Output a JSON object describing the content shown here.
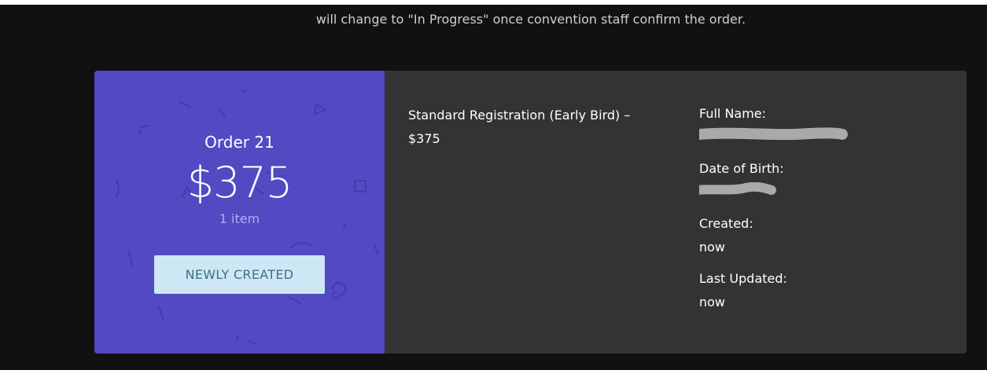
{
  "notice": {
    "text": "will change to \"In Progress\" once convention staff confirm the order."
  },
  "order": {
    "title": "Order 21",
    "total": "$375",
    "item_count": "1 item",
    "status_label": "NEWLY CREATED",
    "line_item": {
      "name": "Standard Registration (Early Bird) –",
      "price": "$375"
    },
    "details": {
      "full_name_label": "Full Name:",
      "dob_label": "Date of Birth:",
      "created_label": "Created:",
      "created_value": "now",
      "updated_label": "Last Updated:",
      "updated_value": "now"
    }
  },
  "colors": {
    "page_bg": "#111111",
    "card_left_bg": "#5249c3",
    "card_right_bg": "#333333",
    "status_button_bg": "#cde8f4",
    "status_button_text": "#3d6f88",
    "redaction": "#a9a9ab"
  }
}
